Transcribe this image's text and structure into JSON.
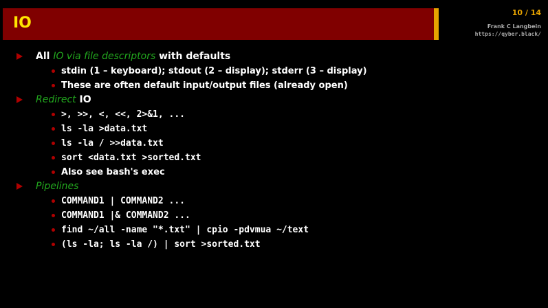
{
  "header": {
    "title": "IO",
    "slide_number": "10 / 14",
    "author": "Frank C Langbein",
    "url": "https://qyber.black/"
  },
  "items": [
    {
      "pre": "All ",
      "em": "IO via file descriptors",
      "post": " with defaults",
      "subitems": [
        {
          "text": "stdin (1 – keyboard); stdout (2 – display); stderr (3 – display)"
        },
        {
          "text": "These are often default input/output files (already open)"
        }
      ]
    },
    {
      "pre": "",
      "em": "Redirect",
      "post": " IO",
      "subitems": [
        {
          "code": ">, >>, <, <<, 2>&1, ..."
        },
        {
          "code": "ls -la >data.txt"
        },
        {
          "code": "ls -la / >>data.txt"
        },
        {
          "code": "sort <data.txt >sorted.txt"
        },
        {
          "text": "Also see bash's exec"
        }
      ]
    },
    {
      "pre": "",
      "em": "Pipelines",
      "post": "",
      "subitems": [
        {
          "code": "COMMAND1 | COMMAND2 ..."
        },
        {
          "code": "COMMAND1 |& COMMAND2 ..."
        },
        {
          "code": "find ~/all -name \"*.txt\" | cpio -pdvmua ~/text"
        },
        {
          "code": "(ls -la; ls -la /) | sort >sorted.txt"
        }
      ]
    }
  ],
  "colors": {
    "title_bar": "#800000",
    "title_text": "#ffe500",
    "accent": "#e8a400",
    "emphasis": "#22a81e",
    "bullet": "#b00000"
  }
}
